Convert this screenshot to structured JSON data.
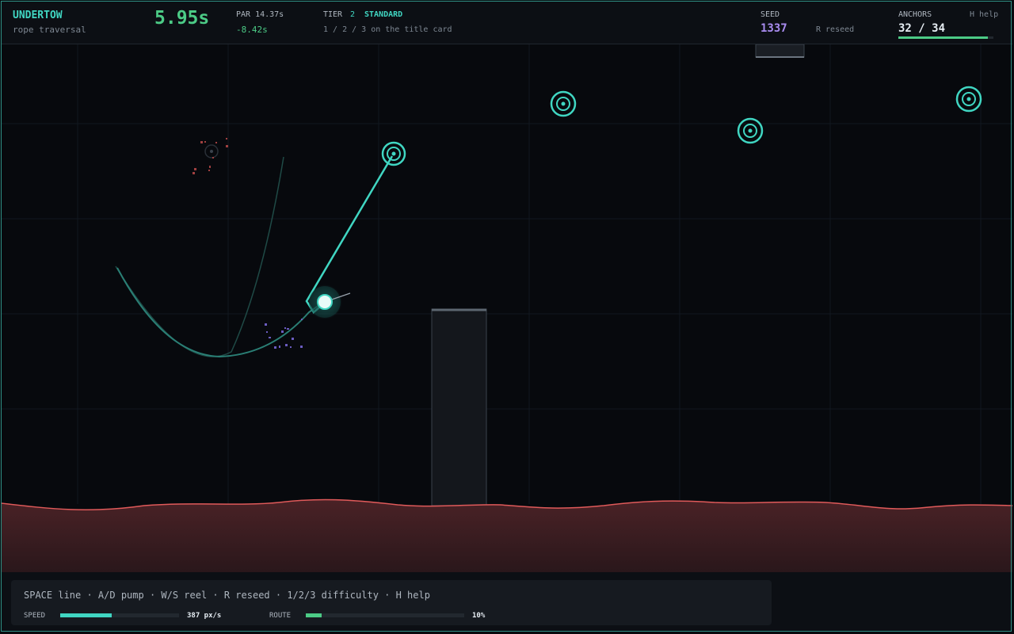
{
  "hud": {
    "title": "UNDERTOW",
    "subtitle": "rope traversal",
    "timer": "5.95s",
    "par": "PAR 14.37s",
    "delta": "-8.42s",
    "tier_label": "TIER",
    "tier_number": "2",
    "tier_name": "STANDARD",
    "tier_hint": "1 / 2 / 3  on the title card",
    "seed_label": "SEED",
    "seed_value": "1337",
    "reseed_hint": "R  reseed",
    "anchors_label": "ANCHORS",
    "help_hint": "H  help",
    "anchors_value": "32 / 34",
    "anchors_fraction": 0.94
  },
  "footer": {
    "keys": "SPACE line · A/D pump · W/S reel · R reseed · 1/2/3 difficulty · H help",
    "speed_label": "SPEED",
    "speed_value": "387 px/s",
    "speed_fraction": 0.43,
    "route_label": "ROUTE",
    "route_value": "10%",
    "route_fraction": 0.1
  },
  "colors": {
    "accent": "#40d6c2",
    "timer": "#4ccb86",
    "seed": "#a98cf0",
    "water": "#e05a5a",
    "water_fill": "#4a2226"
  },
  "icons": {
    "anchor": "target-ring-icon",
    "player": "glowing-orb-icon"
  }
}
